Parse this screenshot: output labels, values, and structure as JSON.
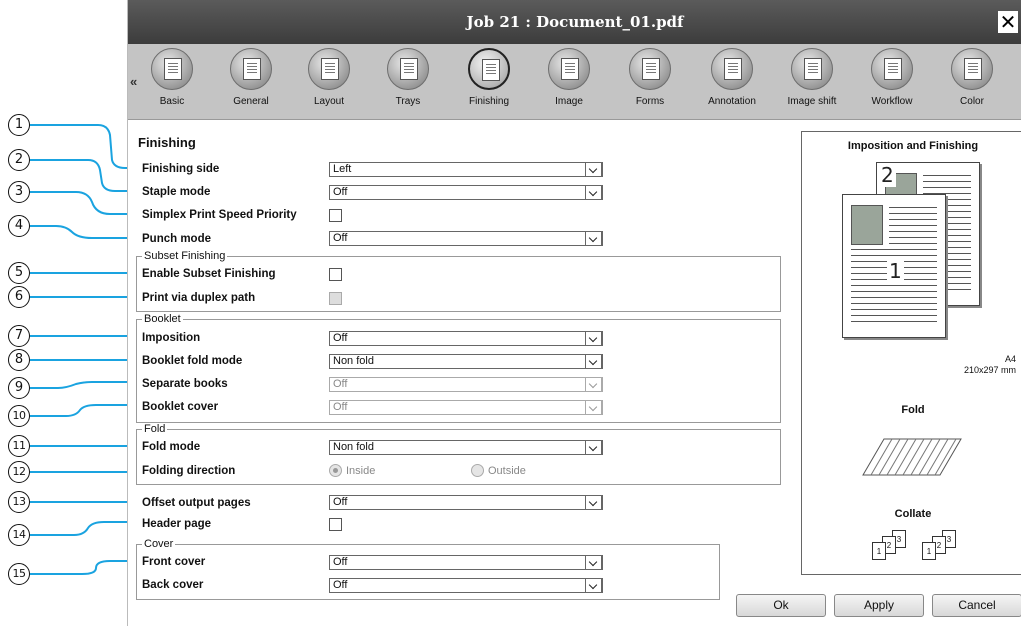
{
  "window": {
    "title": "Job 21 : Document_01.pdf"
  },
  "toolbar": {
    "items": [
      {
        "label": "Basic"
      },
      {
        "label": "General"
      },
      {
        "label": "Layout"
      },
      {
        "label": "Trays"
      },
      {
        "label": "Finishing"
      },
      {
        "label": "Image"
      },
      {
        "label": "Forms"
      },
      {
        "label": "Annotation"
      },
      {
        "label": "Image shift"
      },
      {
        "label": "Workflow"
      },
      {
        "label": "Color"
      }
    ],
    "active": "Finishing"
  },
  "section_title": "Finishing",
  "fields": {
    "finishing_side": {
      "label": "Finishing side",
      "value": "Left"
    },
    "staple_mode": {
      "label": "Staple mode",
      "value": "Off"
    },
    "simplex_speed": {
      "label": "Simplex Print Speed Priority"
    },
    "punch_mode": {
      "label": "Punch mode",
      "value": "Off"
    }
  },
  "subset": {
    "legend": "Subset Finishing",
    "enable": {
      "label": "Enable Subset Finishing"
    },
    "duplex_path": {
      "label": "Print via duplex path"
    }
  },
  "booklet": {
    "legend": "Booklet",
    "imposition": {
      "label": "Imposition",
      "value": "Off"
    },
    "fold_mode": {
      "label": "Booklet fold mode",
      "value": "Non fold"
    },
    "separate_books": {
      "label": "Separate books",
      "value": "Off"
    },
    "cover": {
      "label": "Booklet cover",
      "value": "Off"
    }
  },
  "fold": {
    "legend": "Fold",
    "mode": {
      "label": "Fold mode",
      "value": "Non fold"
    },
    "direction": {
      "label": "Folding direction",
      "inside": "Inside",
      "outside": "Outside"
    }
  },
  "offset": {
    "label": "Offset output pages",
    "value": "Off"
  },
  "header_page": {
    "label": "Header page"
  },
  "cover": {
    "legend": "Cover",
    "front": {
      "label": "Front cover",
      "value": "Off"
    },
    "back": {
      "label": "Back cover",
      "value": "Off"
    }
  },
  "preview": {
    "title": "Imposition and Finishing",
    "page1": "1",
    "page2": "2",
    "paper": "A4",
    "paper_size": "210x297 mm",
    "fold_label": "Fold",
    "collate_label": "Collate"
  },
  "buttons": {
    "ok": "Ok",
    "apply": "Apply",
    "cancel": "Cancel"
  },
  "callouts": [
    "1",
    "2",
    "3",
    "4",
    "5",
    "6",
    "7",
    "8",
    "9",
    "10",
    "11",
    "12",
    "13",
    "14",
    "15"
  ]
}
